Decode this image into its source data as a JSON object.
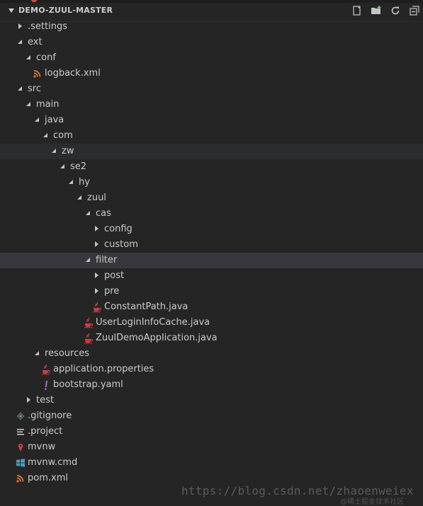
{
  "explorer": {
    "title": "DEMO-ZUUL-MASTER",
    "actions": [
      {
        "name": "new-file-icon"
      },
      {
        "name": "new-folder-icon"
      },
      {
        "name": "refresh-icon"
      },
      {
        "name": "collapse-all-icon"
      }
    ]
  },
  "tree": [
    {
      "label": ".settings",
      "depth": 0,
      "kind": "folder",
      "expanded": false
    },
    {
      "label": "ext",
      "depth": 0,
      "kind": "folder",
      "expanded": true
    },
    {
      "label": "conf",
      "depth": 1,
      "kind": "folder",
      "expanded": true
    },
    {
      "label": "logback.xml",
      "depth": 2,
      "kind": "file",
      "icon": "xml-icon"
    },
    {
      "label": "src",
      "depth": 0,
      "kind": "folder",
      "expanded": true
    },
    {
      "label": "main",
      "depth": 1,
      "kind": "folder",
      "expanded": true
    },
    {
      "label": "java",
      "depth": 2,
      "kind": "folder",
      "expanded": true
    },
    {
      "label": "com",
      "depth": 3,
      "kind": "folder",
      "expanded": true
    },
    {
      "label": "zw",
      "depth": 4,
      "kind": "folder",
      "expanded": true,
      "highlight": "light"
    },
    {
      "label": "se2",
      "depth": 5,
      "kind": "folder",
      "expanded": true
    },
    {
      "label": "hy",
      "depth": 6,
      "kind": "folder",
      "expanded": true
    },
    {
      "label": "zuul",
      "depth": 7,
      "kind": "folder",
      "expanded": true
    },
    {
      "label": "cas",
      "depth": 8,
      "kind": "folder",
      "expanded": true
    },
    {
      "label": "config",
      "depth": 9,
      "kind": "folder",
      "expanded": false
    },
    {
      "label": "custom",
      "depth": 9,
      "kind": "folder",
      "expanded": false
    },
    {
      "label": "filter",
      "depth": 8,
      "kind": "folder",
      "expanded": true,
      "highlight": "selected"
    },
    {
      "label": "post",
      "depth": 9,
      "kind": "folder",
      "expanded": false
    },
    {
      "label": "pre",
      "depth": 9,
      "kind": "folder",
      "expanded": false
    },
    {
      "label": "ConstantPath.java",
      "depth": 9,
      "kind": "file",
      "icon": "java-icon"
    },
    {
      "label": "UserLoginInfoCache.java",
      "depth": 8,
      "kind": "file",
      "icon": "java-icon"
    },
    {
      "label": "ZuulDemoApplication.java",
      "depth": 8,
      "kind": "file",
      "icon": "java-icon"
    },
    {
      "label": "resources",
      "depth": 2,
      "kind": "folder",
      "expanded": true
    },
    {
      "label": "application.properties",
      "depth": 3,
      "kind": "file",
      "icon": "java-icon"
    },
    {
      "label": "bootstrap.yaml",
      "depth": 3,
      "kind": "file",
      "icon": "yaml-icon"
    },
    {
      "label": "test",
      "depth": 1,
      "kind": "folder",
      "expanded": false
    },
    {
      "label": ".gitignore",
      "depth": 0,
      "kind": "file",
      "icon": "git-icon"
    },
    {
      "label": ".project",
      "depth": 0,
      "kind": "file",
      "icon": "text-lines-icon"
    },
    {
      "label": "mvnw",
      "depth": 0,
      "kind": "file",
      "icon": "pin-icon"
    },
    {
      "label": "mvnw.cmd",
      "depth": 0,
      "kind": "file",
      "icon": "windows-icon"
    },
    {
      "label": "pom.xml",
      "depth": 0,
      "kind": "file",
      "icon": "xml-icon"
    }
  ],
  "watermark": {
    "text": "https://blog.csdn.net/zhaoenweiex",
    "subtext": "@稀土掘金技术社区"
  }
}
